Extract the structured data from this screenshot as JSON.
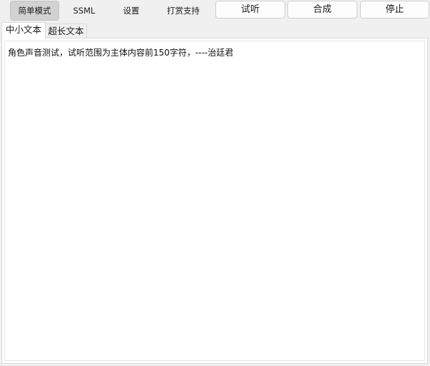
{
  "mode_tabs": [
    {
      "label": "简单模式",
      "active": true
    },
    {
      "label": "SSML",
      "active": false
    },
    {
      "label": "设置",
      "active": false
    },
    {
      "label": "打赏支持",
      "active": false
    }
  ],
  "actions": {
    "audition": "试听",
    "synthesize": "合成",
    "stop": "停止"
  },
  "sub_tabs": [
    {
      "label": "中小文本",
      "active": true
    },
    {
      "label": "超长文本",
      "active": false
    }
  ],
  "editor": {
    "text": "角色声音测试，试听范围为主体内容前150字符，----治廷君"
  }
}
